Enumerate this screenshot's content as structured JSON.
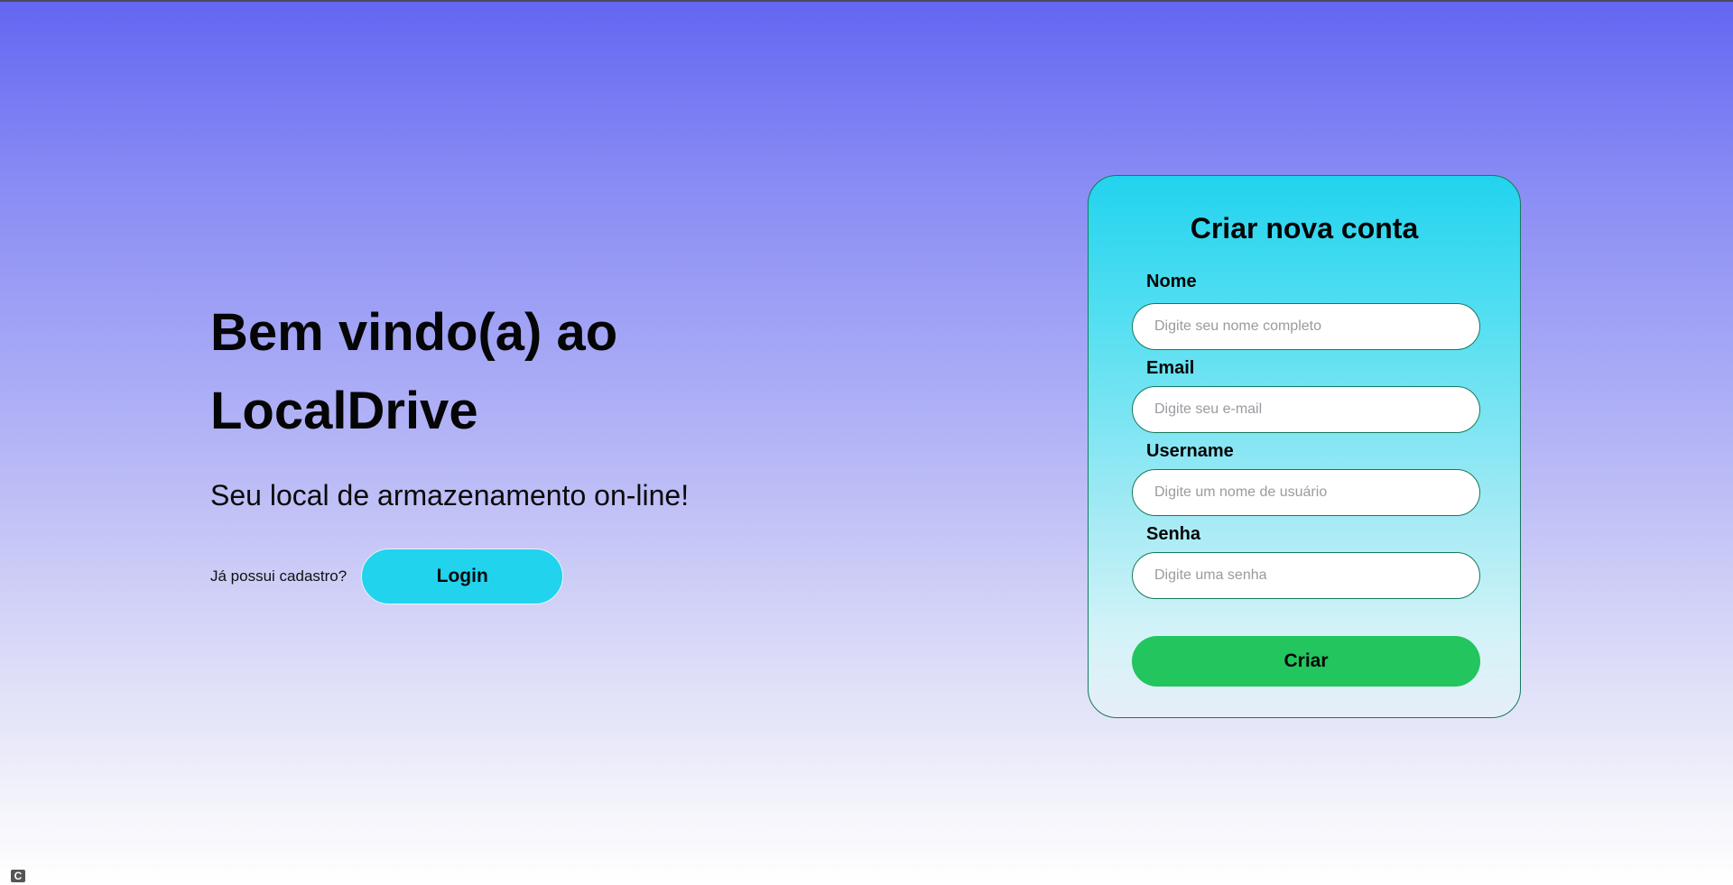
{
  "hero": {
    "title_line1": "Bem vindo(a) ao",
    "title_line2": "LocalDrive",
    "subtitle": "Seu local de armazenamento on-line!"
  },
  "login": {
    "question": "Já possui cadastro?",
    "button_label": "Login"
  },
  "signup_form": {
    "title": "Criar nova conta",
    "fields": [
      {
        "label": "Nome",
        "placeholder": "Digite seu nome completo"
      },
      {
        "label": "Email",
        "placeholder": "Digite seu e-mail"
      },
      {
        "label": "Username",
        "placeholder": "Digite um nome de usuário"
      },
      {
        "label": "Senha",
        "placeholder": "Digite uma senha"
      }
    ],
    "submit_label": "Criar"
  },
  "corner_icon": {
    "icon": "extension-c-icon",
    "glyph": "C"
  },
  "colors": {
    "background_top": "#6366f1",
    "background_bottom": "#ffffff",
    "login_button": "#22d3ee",
    "card_gradient_top": "#22d3ee",
    "card_border": "#137a5c",
    "submit_button": "#22c55e"
  }
}
